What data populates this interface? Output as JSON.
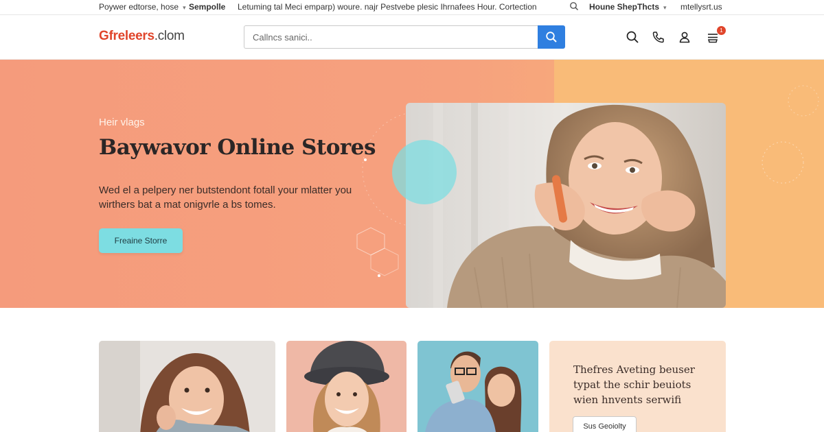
{
  "topbar": {
    "item1": "Poywer edtorse, hose",
    "item2": "Sempolle",
    "promo": "Letuming tal Meci emparp) woure. najr Pestvebe plesic Ihrnafees Hour. Cortection",
    "nav": "Houne ShepThcts",
    "account": "mtellysrt.us"
  },
  "header": {
    "logo_brand": "Gfreleers",
    "logo_tld": ".clom",
    "search_placeholder": "Callncs sanici..",
    "cart_count": "1"
  },
  "hero": {
    "kicker": "Heir vlags",
    "title": "Baywavor Online Stores",
    "description": "Wed el a pelpery ner butstendont fotall your mlatter you wirthers bat a mat onigvrle a bs tomes.",
    "cta_label": "Freaine Storre"
  },
  "promo": {
    "text": "Thefres Aveting beuser typat the schir beuiots wien hnvents serwifi",
    "button_label": "Sus Geoiolty"
  },
  "colors": {
    "brand_red": "#e0452b",
    "search_blue": "#2f7fe0",
    "hero_peach": "#f59b7c",
    "hero_orange": "#f9bb78",
    "cta_teal": "#7ddde2",
    "promo_bg": "#fae1cd"
  },
  "icons": [
    "search-icon",
    "phone-icon",
    "user-icon",
    "cart-icon"
  ]
}
